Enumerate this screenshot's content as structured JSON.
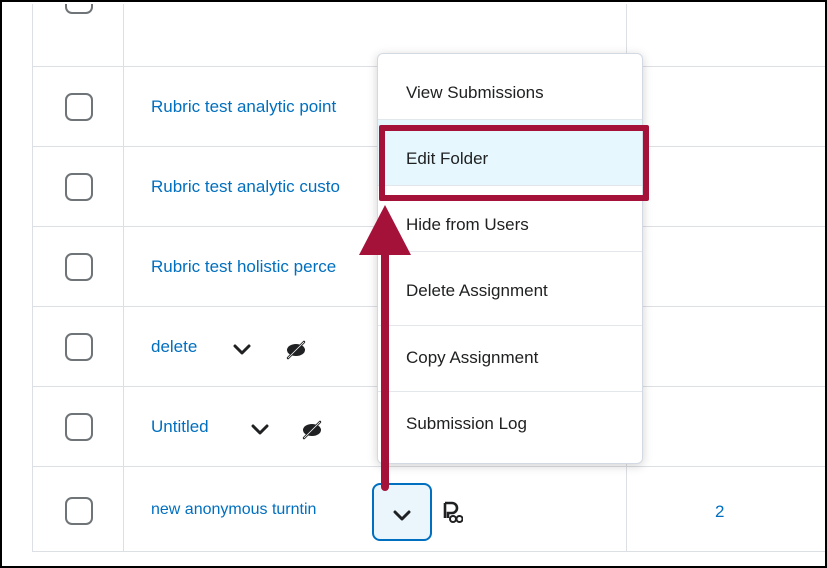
{
  "rows": [
    {
      "label": "Rubric test analytic point"
    },
    {
      "label": "Rubric test analytic custo"
    },
    {
      "label": "Rubric test holistic perce"
    },
    {
      "label": "delete"
    },
    {
      "label": "Untitled"
    },
    {
      "label": "new anonymous turntin",
      "submissions": "2"
    }
  ],
  "context_menu": {
    "items": [
      {
        "label": "View Submissions"
      },
      {
        "label": "Edit Folder",
        "highlighted": true
      },
      {
        "label": "Hide from Users"
      },
      {
        "label": "Delete Assignment"
      },
      {
        "label": "Copy Assignment"
      },
      {
        "label": "Submission Log"
      }
    ]
  },
  "colors": {
    "link": "#006fbf",
    "highlight": "#a4123a",
    "arrow": "#a4123a",
    "active_item_bg": "#e6f8fd"
  },
  "icons": {
    "row_action": "chevron-down-icon",
    "visibility": "hidden-eye-icon",
    "anonymous": "anonymous-marking-icon"
  }
}
